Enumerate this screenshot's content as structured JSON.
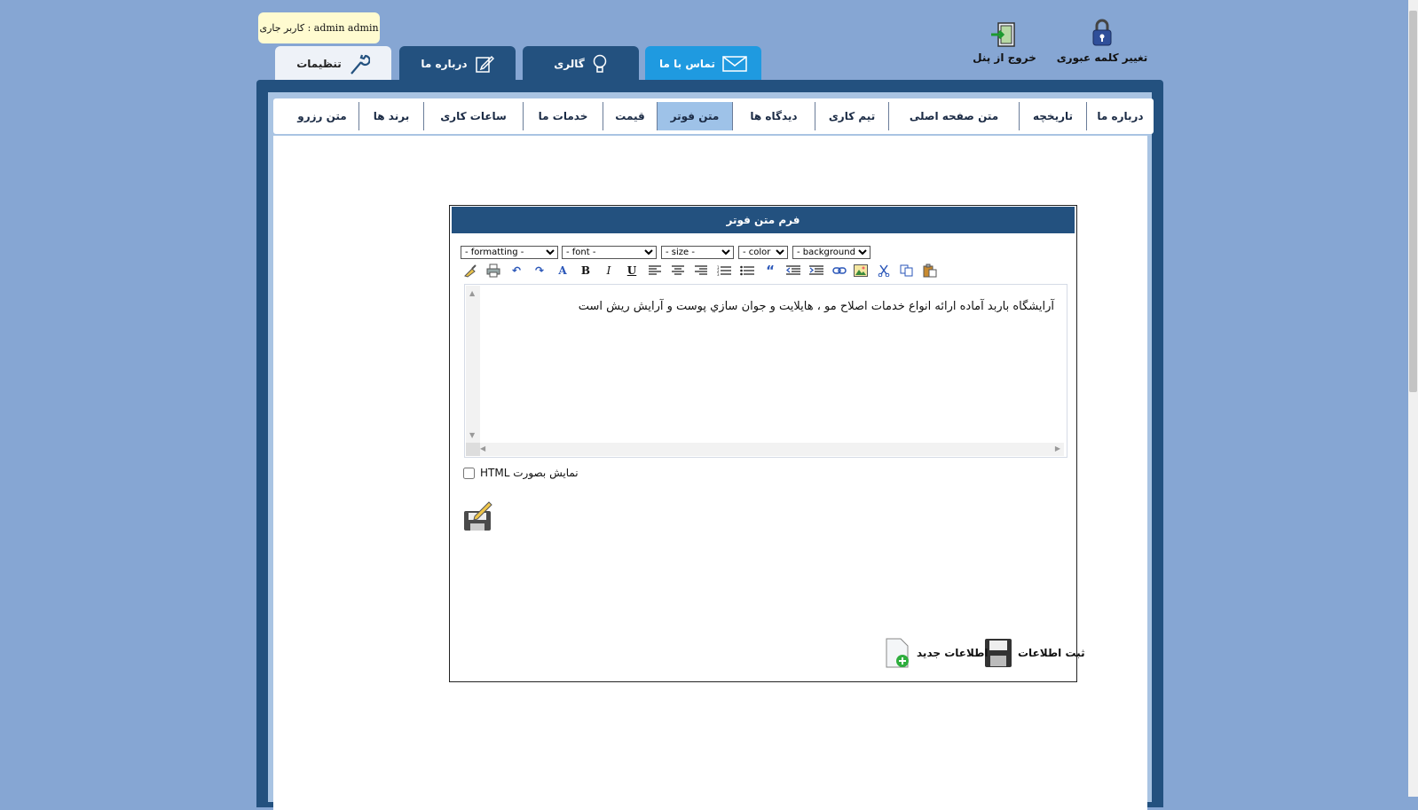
{
  "user_note": {
    "text": "admin admin : کاربر جاری"
  },
  "top_actions": {
    "change_password": "تغییر کلمه عبوری",
    "logout": "خروج از پنل"
  },
  "main_tabs": [
    {
      "label": "تماس با ما",
      "icon": "envelope-icon"
    },
    {
      "label": "گالری",
      "icon": "lightbulb-icon"
    },
    {
      "label": "درباره ما",
      "icon": "edit-note-icon"
    },
    {
      "label": "تنظیمات",
      "icon": "wrench-icon"
    }
  ],
  "sub_tabs": [
    {
      "label": "درباره ما"
    },
    {
      "label": "تاریخچه"
    },
    {
      "label": "متن صفحه اصلی"
    },
    {
      "label": "تیم کاری"
    },
    {
      "label": "دیدگاه ها"
    },
    {
      "label": "متن فوتر"
    },
    {
      "label": "قیمت"
    },
    {
      "label": "خدمات ما"
    },
    {
      "label": "ساعات کاری"
    },
    {
      "label": "برند ها"
    },
    {
      "label": "متن رزرو"
    }
  ],
  "form": {
    "title": "فرم متن فوتر",
    "selects": {
      "formatting": "- formatting -",
      "font": "- font -",
      "size": "- size -",
      "color": "- color -",
      "background": "- background -"
    },
    "toolbar_icons": [
      "clean-icon",
      "print-icon",
      "undo-icon",
      "redo-icon",
      "spellcheck-icon",
      "bold-icon",
      "italic-icon",
      "underline-icon",
      "align-left-icon",
      "align-center-icon",
      "align-right-icon",
      "ordered-list-icon",
      "unordered-list-icon",
      "quote-icon",
      "outdent-icon",
      "indent-icon",
      "link-icon",
      "image-icon",
      "cut-icon",
      "copy-icon",
      "paste-icon"
    ],
    "editor_text": "آرایشگاه باربد آماده ارائه انواع خدمات اصلاح مو ، هایلایت و جوان سازي پوست و آرایش ریش است",
    "html_checkbox_label": "نمایش بصورت HTML",
    "save_label": "ثبت اطلاعات",
    "new_label": "اطلاعات جدید"
  },
  "colors": {
    "background": "#86a6d3",
    "dark_blue": "#23517f",
    "light_blue_tab": "#1f9ae0",
    "active_subtab": "#9ec2e8"
  }
}
